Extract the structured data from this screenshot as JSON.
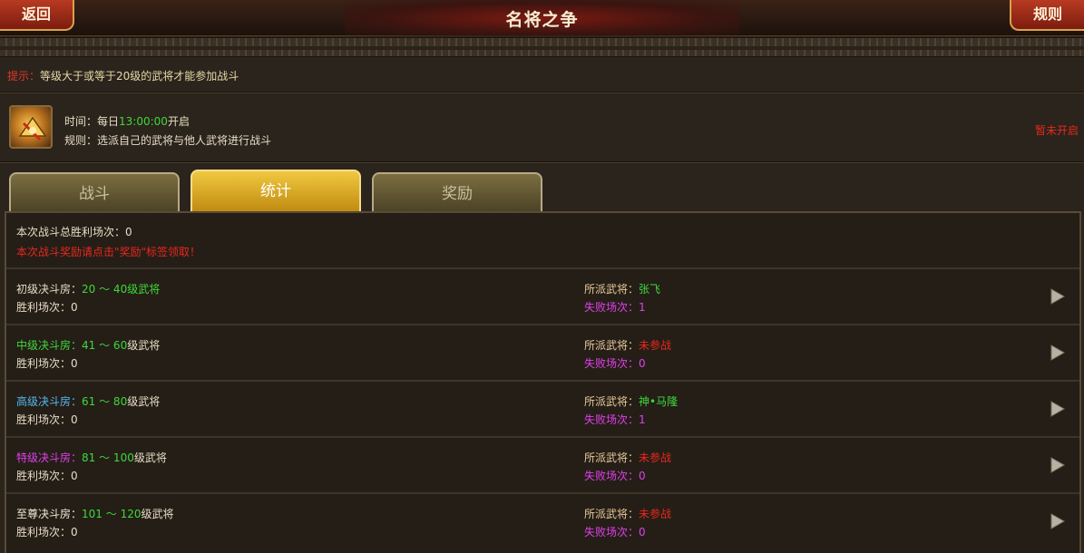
{
  "header": {
    "back_label": "返回",
    "title": "名将之争",
    "rules_label": "规则"
  },
  "tip": {
    "lead": "提示：",
    "text": "等级大于或等于20级的武将才能参加战斗"
  },
  "info": {
    "time_label": "时间：",
    "time_prefix": "每日",
    "time_value": "13:00:00",
    "time_suffix": "开启",
    "rule_label": "规则：",
    "rule_text": "选派自己的武将与他人武将进行战斗",
    "status": "暂未开启"
  },
  "tabs": [
    {
      "label": "战斗",
      "active": false
    },
    {
      "label": "统计",
      "active": true
    },
    {
      "label": "奖励",
      "active": false
    }
  ],
  "summary": {
    "total_label": "本次战斗总胜利场次：",
    "total_value": "0",
    "notice": "本次战斗奖励请点击\"奖励\"标签领取！"
  },
  "rooms": [
    {
      "name": "初级决斗房",
      "sep": "：",
      "range": "20 ～ 40",
      "unit": "级武将",
      "wins_label": "胜利场次：",
      "wins": "0",
      "general_label": "所派武将：",
      "general": "张飞",
      "losses_label": "失败场次：",
      "losses": "1"
    },
    {
      "name": "中级决斗房",
      "sep": "：",
      "range": "41 ～ 60",
      "unit": "级武将",
      "wins_label": "胜利场次：",
      "wins": "0",
      "general_label": "所派武将：",
      "general": "未参战",
      "losses_label": "失败场次：",
      "losses": "0"
    },
    {
      "name": "高级决斗房",
      "sep": "：",
      "range": "61 ～ 80",
      "unit": "级武将",
      "wins_label": "胜利场次：",
      "wins": "0",
      "general_label": "所派武将：",
      "general": "神•马隆",
      "losses_label": "失败场次：",
      "losses": "1"
    },
    {
      "name": "特级决斗房",
      "sep": "：",
      "range": "81 ～ 100",
      "unit": "级武将",
      "wins_label": "胜利场次：",
      "wins": "0",
      "general_label": "所派武将：",
      "general": "未参战",
      "losses_label": "失败场次：",
      "losses": "0"
    },
    {
      "name": "至尊决斗房",
      "sep": "：",
      "range": "101 ～ 120",
      "unit": "级武将",
      "wins_label": "胜利场次：",
      "wins": "0",
      "general_label": "所派武将：",
      "general": "未参战",
      "losses_label": "失败场次：",
      "losses": "0"
    }
  ],
  "colors": {
    "accent_red": "#e8281c",
    "green": "#3fd83a",
    "magenta": "#e040e8",
    "sky": "#56b8f0",
    "gold_tab": "#f0c840"
  }
}
